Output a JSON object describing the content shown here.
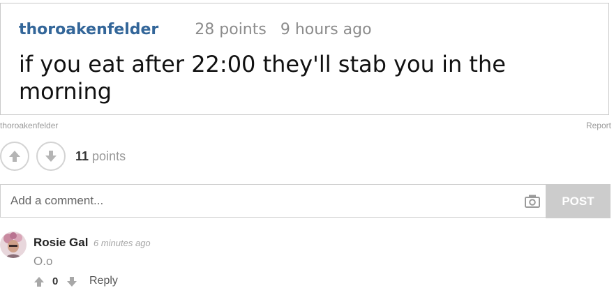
{
  "post": {
    "author": "thoroakenfelder",
    "points": "28 points",
    "time": "9 hours ago",
    "text": "if you eat after 22:00 they'll stab you in the morning"
  },
  "byline": {
    "author": "thoroakenfelder",
    "report": "Report"
  },
  "votes": {
    "count": "11",
    "unit": "points"
  },
  "comment_form": {
    "placeholder": "Add a comment...",
    "post_label": "POST"
  },
  "comments": [
    {
      "author": "Rosie Gal",
      "time": "6 minutes ago",
      "text": "O.o",
      "votes": "0",
      "reply_label": "Reply"
    }
  ],
  "colors": {
    "author_link": "#336699",
    "post_button": "#cccccc",
    "border": "#c9c9c9",
    "muted": "#8c8c8c"
  },
  "icons": [
    "upvote-icon",
    "downvote-icon",
    "camera-icon",
    "avatar"
  ]
}
